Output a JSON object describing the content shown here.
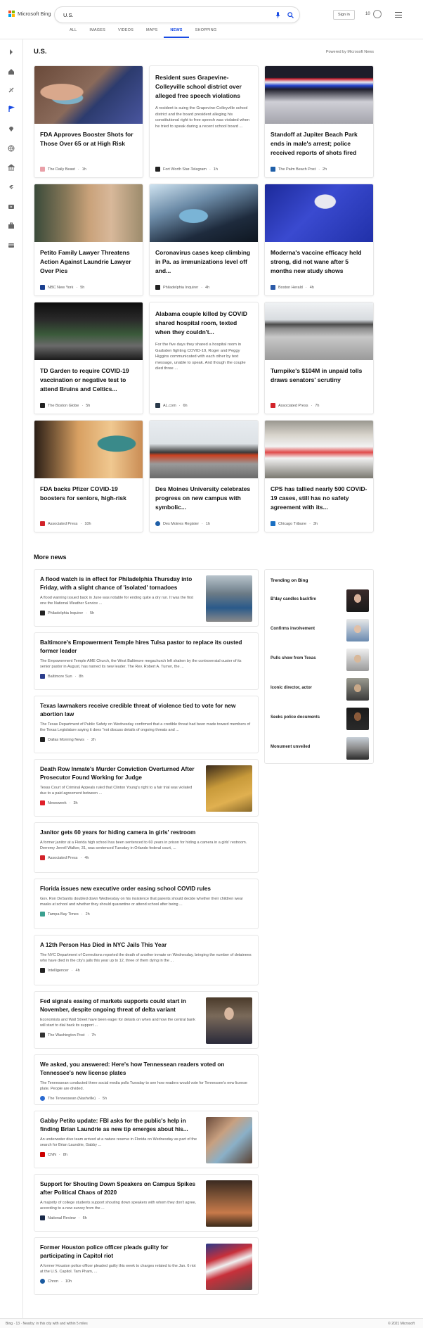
{
  "header": {
    "brand": "Microsoft Bing",
    "search_value": "U.S.",
    "signin_label": "Sign in",
    "rewards_count": "10",
    "nav_tabs": [
      "ALL",
      "IMAGES",
      "VIDEOS",
      "MAPS",
      "NEWS",
      "SHOPPING"
    ],
    "active_tab": "NEWS"
  },
  "section": {
    "title": "U.S.",
    "powered_by": "Powered by Microsoft News"
  },
  "cards": [
    {
      "title": "FDA Approves Booster Shots for Those Over 65 or at High Risk",
      "source": "The Daily Beast",
      "age": "1h",
      "logo_color": "#e9a0a8"
    },
    {
      "title": "Resident sues Grapevine-Colleyville school district over alleged free speech violations",
      "snippet": "A resident is suing the Grapevine-Colleyville school district and the board president alleging his constitutional right to free speech was violated when he tried to speak during a recent school board ...",
      "source": "Fort Worth Star-Telegram",
      "age": "1h",
      "logo_color": "#222222"
    },
    {
      "title": "Standoff at Jupiter Beach Park ends in male's arrest; police received reports of shots fired",
      "source": "The Palm Beach Post",
      "age": "2h",
      "logo_color": "#1f5fa8"
    },
    {
      "title": "Petito Family Lawyer Threatens Action Against Laundrie Lawyer Over Pics",
      "source": "NBC New York",
      "age": "5h",
      "logo_color": "#1a3f8f"
    },
    {
      "title": "Coronavirus cases keep climbing in Pa. as immunizations level off and...",
      "source": "Philadelphia Inquirer",
      "age": "4h",
      "logo_color": "#222222"
    },
    {
      "title": "Moderna's vaccine efficacy held strong, did not wane after 5 months new study shows",
      "source": "Boston Herald",
      "age": "4h",
      "logo_color": "#2b5aa8"
    },
    {
      "title": "TD Garden to require COVID-19 vaccination or negative test to attend Bruins and Celtics...",
      "source": "The Boston Globe",
      "age": "5h",
      "logo_color": "#222222"
    },
    {
      "title": "Alabama couple killed by COVID shared hospital room, texted when they couldn't...",
      "snippet": "For the five days they shared a hospital room in Gadsden fighting COVID-19, Roger and Peggy Higgins communicated with each other by text message, unable to speak. And though the couple died three ...",
      "source": "AL.com",
      "age": "6h",
      "logo_color": "#2a3a4a"
    },
    {
      "title": "Turnpike's $104M in unpaid tolls draws senators' scrutiny",
      "source": "Associated Press",
      "age": "7h",
      "logo_color": "#d2232a"
    },
    {
      "title": "FDA backs Pfizer COVID-19 boosters for seniors, high-risk",
      "source": "Associated Press",
      "age": "10h",
      "logo_color": "#d2232a"
    },
    {
      "title": "Des Moines University celebrates progress on new campus with symbolic...",
      "source": "Des Moines Register",
      "age": "1h",
      "logo_color": "#1f5fa8"
    },
    {
      "title": "CPS has tallied nearly 500 COVID-19 cases, still has no safety agreement with its...",
      "source": "Chicago Tribune",
      "age": "3h",
      "logo_color": "#1a6fc2"
    }
  ],
  "more_news": {
    "title": "More news",
    "items": [
      {
        "title": "A flood watch is in effect for Philadelphia Thursday into Friday, with a slight chance of 'isolated' tornadoes",
        "snippet": "A flood warning issued back in June was notable for ending quite a dry run. It was the first one the National Weather Service ...",
        "source": "Philadelphia Inquirer",
        "age": "5h"
      },
      {
        "title": "Baltimore's Empowerment Temple hires Tulsa pastor to replace its ousted former leader",
        "snippet": "The Empowerment Temple AME Church, the West Baltimore megachurch left shaken by the controversial ouster of its senior pastor in August, has named its new leader. The Rev. Robert A. Turner, the ...",
        "source": "Baltimore Sun",
        "age": "8h"
      },
      {
        "title": "Texas lawmakers receive credible threat of violence tied to vote for new abortion law",
        "snippet": "The Texas Department of Public Safety on Wednesday confirmed that a credible threat had been made toward members of the Texas Legislature saying it does \"not discuss details of ongoing threats and ...",
        "source": "Dallas Morning News",
        "age": "2h"
      },
      {
        "title": "Death Row Inmate's Murder Conviction Overturned After Prosecutor Found Working for Judge",
        "snippet": "Texas Court of Criminal Appeals ruled that Clinton Young's right to a fair trial was violated due to a paid agreement between ...",
        "source": "Newsweek",
        "age": "3h"
      },
      {
        "title": "Janitor gets 60 years for hiding camera in girls' restroom",
        "snippet": "A former janitor at a Florida high school has been sentenced to 60 years in prison for hiding a camera in a girls' restroom. Derremy Jerrell Walker, 31, was sentenced Tuesday in Orlando federal court, ...",
        "source": "Associated Press",
        "age": "4h"
      },
      {
        "title": "Florida issues new executive order easing school COVID rules",
        "snippet": "Gov. Ron DeSantis doubled down Wednesday on his insistence that parents should decide whether their children wear masks at school and whether they should quarantine or attend school after being ...",
        "source": "Tampa Bay Times",
        "age": "2h"
      },
      {
        "title": "A 12th Person Has Died in NYC Jails This Year",
        "snippet": "The NYC Department of Corrections reported the death of another inmate on Wednesday, bringing the number of detainees who have died in the city's jails this year up to 12, three of them dying in the ...",
        "source": "Intelligencer",
        "age": "4h"
      },
      {
        "title": "Fed signals easing of markets supports could start in November, despite ongoing threat of delta variant",
        "snippet": "Economists and Wall Street have been eager for details on when and how the central bank will start to dial back its support ...",
        "source": "The Washington Post",
        "age": "7h"
      },
      {
        "title": "We asked, you answered: Here's how Tennessean readers voted on Tennessee's new license plates",
        "snippet": "The Tennessean conducted three social media polls Tuesday to see how readers would vote for Tennessee's new license plate. People are divided.",
        "source": "The Tennessean (Nashville)",
        "age": "5h"
      },
      {
        "title": "Gabby Petito update: FBI asks for the public's help in finding Brian Laundrie as new tip emerges about his...",
        "snippet": "An underwater dive team arrived at a nature reserve in Florida on Wednesday as part of the search for Brian Laundrie, Gabby ...",
        "source": "CNN",
        "age": "8h"
      },
      {
        "title": "Support for Shouting Down Speakers on Campus Spikes after Political Chaos of 2020",
        "snippet": "A majority of college students support shouting down speakers with whom they don't agree, according to a new survey from the ...",
        "source": "National Review",
        "age": "6h"
      },
      {
        "title": "Former Houston police officer pleads guilty for participating in Capitol riot",
        "snippet": "A former Houston police officer pleaded guilty this week to charges related to the Jan. 6 riot at the U.S. Capitol. Tam Pham, ...",
        "source": "Chron",
        "age": "10h"
      }
    ]
  },
  "trending": {
    "title": "Trending on Bing",
    "items": [
      "B'day candles backfire",
      "Confirms involvement",
      "Pulls show from Texas",
      "Iconic director, actor",
      "Seeks police documents",
      "Monument unveiled"
    ]
  },
  "footer": {
    "left": "Bing · 13 · Nearby: in this city with and within 5 miles",
    "right": "© 2021 Microsoft"
  },
  "colors": {
    "accent": "#174ae4",
    "border": "#e6e6e6",
    "text": "#111111",
    "muted": "#555555"
  }
}
